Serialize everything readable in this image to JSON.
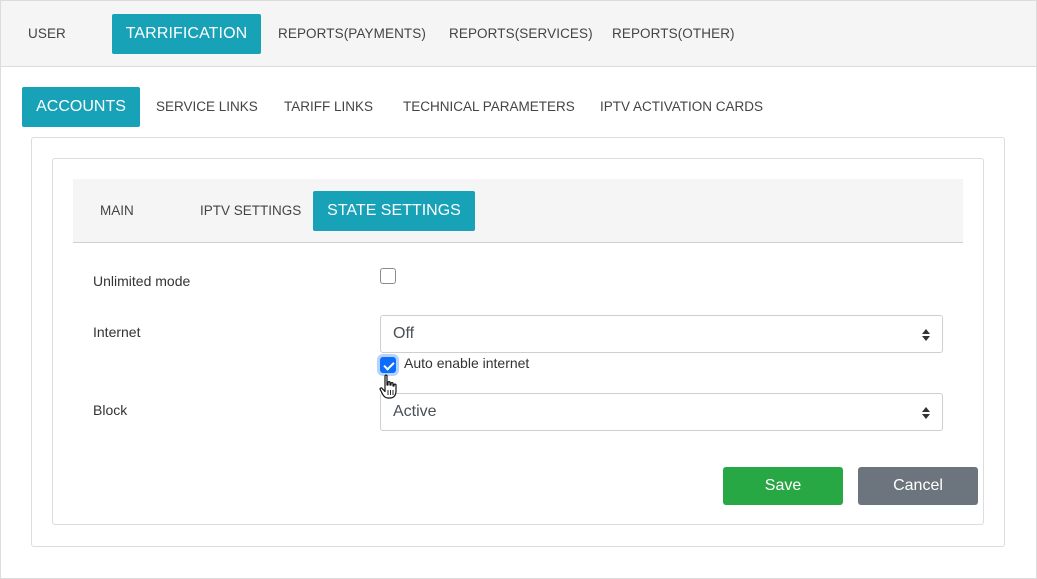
{
  "topnav": {
    "items": [
      {
        "label": "USER"
      },
      {
        "label": "TARRIFICATION",
        "active": true
      },
      {
        "label": "REPORTS(PAYMENTS)"
      },
      {
        "label": "REPORTS(SERVICES)"
      },
      {
        "label": "REPORTS(OTHER)"
      }
    ]
  },
  "subnav": {
    "items": [
      {
        "label": "ACCOUNTS",
        "active": true
      },
      {
        "label": "SERVICE LINKS"
      },
      {
        "label": "TARIFF LINKS"
      },
      {
        "label": "TECHNICAL PARAMETERS"
      },
      {
        "label": "IPTV ACTIVATION CARDS"
      }
    ]
  },
  "tabs": {
    "items": [
      {
        "label": "MAIN"
      },
      {
        "label": "IPTV SETTINGS"
      },
      {
        "label": "STATE SETTINGS",
        "active": true
      }
    ]
  },
  "form": {
    "unlimited_label": "Unlimited mode",
    "unlimited_checked": false,
    "internet_label": "Internet",
    "internet_value": "Off",
    "auto_enable_label": "Auto enable internet",
    "auto_enable_checked": true,
    "block_label": "Block",
    "block_value": "Active"
  },
  "actions": {
    "save_label": "Save",
    "cancel_label": "Cancel"
  },
  "colors": {
    "accent": "#17a2b8",
    "save": "#28a745",
    "cancel": "#6c757d",
    "checkbox": "#0d6efd"
  }
}
